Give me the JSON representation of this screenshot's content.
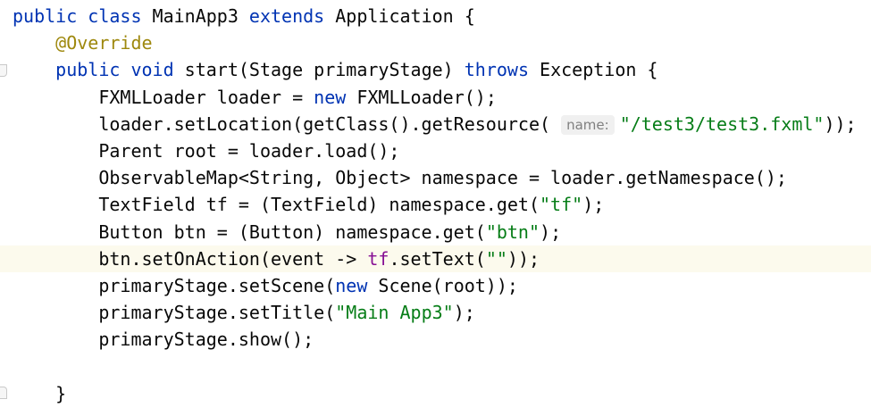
{
  "editor": {
    "lines": [
      [
        {
          "t": "public class",
          "c": "kw"
        },
        {
          "t": " MainApp3 "
        },
        {
          "t": "extends",
          "c": "kw"
        },
        {
          "t": " Application {"
        }
      ],
      [
        {
          "t": "    "
        },
        {
          "t": "@Override",
          "c": "ann"
        }
      ],
      [
        {
          "t": "    "
        },
        {
          "t": "public void",
          "c": "kw"
        },
        {
          "t": " start(Stage primaryStage) "
        },
        {
          "t": "throws",
          "c": "kw"
        },
        {
          "t": " Exception {"
        }
      ],
      [
        {
          "t": "        FXMLLoader loader = "
        },
        {
          "t": "new",
          "c": "kw"
        },
        {
          "t": " FXMLLoader();"
        }
      ],
      [
        {
          "t": "        loader.setLocation(getClass().getResource( "
        },
        {
          "t": "name:",
          "c": "hint"
        },
        {
          "t": "\"/test3/test3.fxml\"",
          "c": "str"
        },
        {
          "t": "));"
        }
      ],
      [
        {
          "t": "        Parent root = loader.load();"
        }
      ],
      [
        {
          "t": "        ObservableMap<String, Object> namespace = loader.getNamespace();"
        }
      ],
      [
        {
          "t": "        TextField tf = (TextField) namespace.get("
        },
        {
          "t": "\"tf\"",
          "c": "str"
        },
        {
          "t": ");"
        }
      ],
      [
        {
          "t": "        Button btn = (Button) namespace.get("
        },
        {
          "t": "\"btn\"",
          "c": "str"
        },
        {
          "t": ");"
        }
      ],
      [
        {
          "t": "        btn.setOnAction(event -> "
        },
        {
          "t": "tf",
          "c": "fld"
        },
        {
          "t": ".setText("
        },
        {
          "t": "\"\"",
          "c": "str"
        },
        {
          "t": "));"
        }
      ],
      [
        {
          "t": "        primaryStage.setScene("
        },
        {
          "t": "new",
          "c": "kw"
        },
        {
          "t": " Scene(root));"
        }
      ],
      [
        {
          "t": "        primaryStage.setTitle("
        },
        {
          "t": "\"Main App3\"",
          "c": "str"
        },
        {
          "t": ");"
        }
      ],
      [
        {
          "t": "        primaryStage.show();"
        }
      ],
      [
        {
          "t": ""
        }
      ],
      [
        {
          "t": "    }"
        }
      ]
    ],
    "current_line": 9
  }
}
